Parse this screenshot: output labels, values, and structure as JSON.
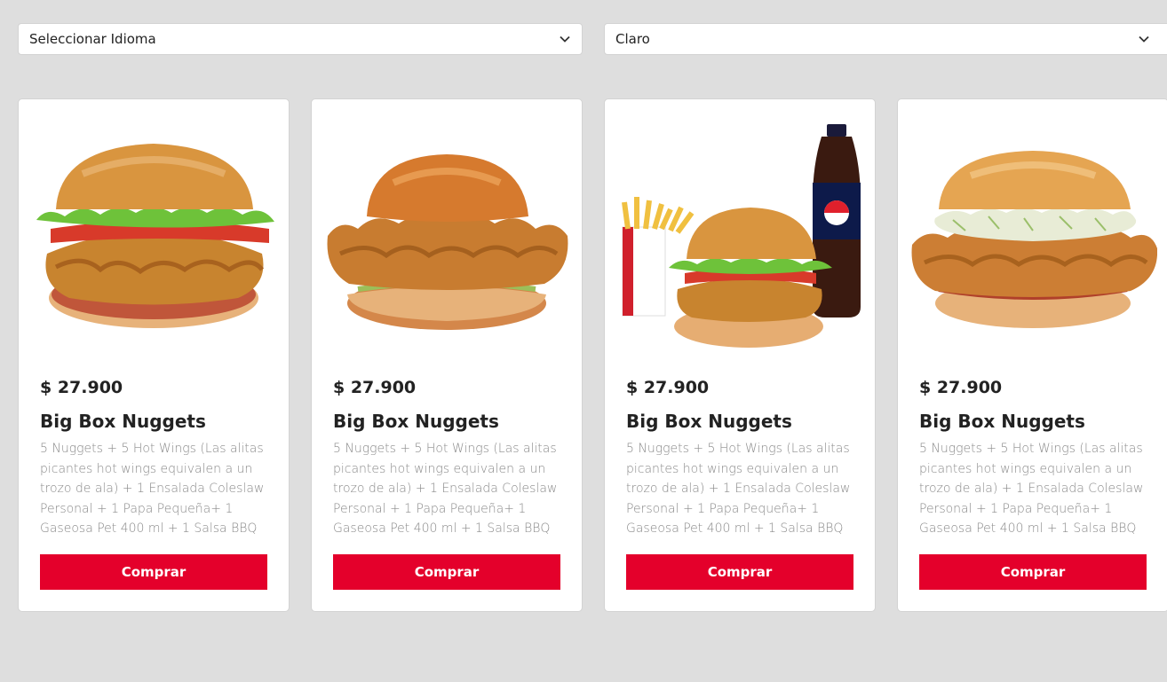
{
  "selectors": {
    "language": {
      "value": "Seleccionar Idioma",
      "icon": "chevron-down-icon"
    },
    "theme": {
      "value": "Claro",
      "icon": "chevron-down-icon"
    }
  },
  "products": [
    {
      "image": "burger-lettuce-tomato",
      "price": "$ 27.900",
      "name": "Big Box Nuggets",
      "description": "5 Nuggets + 5 Hot Wings (Las alitas picantes hot wings equivalen a un trozo de ala) + 1 Ensalada Coleslaw Personal + 1 Papa Pequeña+ 1 Gaseosa Pet 400 ml + 1 Salsa BBQ",
      "button": "Comprar"
    },
    {
      "image": "crispy-chicken-burger",
      "price": "$ 27.900",
      "name": "Big Box Nuggets",
      "description": "5 Nuggets + 5 Hot Wings (Las alitas picantes hot wings equivalen a un trozo de ala) + 1 Ensalada Coleslaw Personal + 1 Papa Pequeña+ 1 Gaseosa Pet 400 ml + 1 Salsa BBQ",
      "button": "Comprar"
    },
    {
      "image": "combo-burger-fries-soda",
      "price": "$ 27.900",
      "name": "Big Box Nuggets",
      "description": "5 Nuggets + 5 Hot Wings (Las alitas picantes hot wings equivalen a un trozo de ala) + 1 Ensalada Coleslaw Personal + 1 Papa Pequeña+ 1 Gaseosa Pet 400 ml + 1 Salsa BBQ",
      "button": "Comprar"
    },
    {
      "image": "coleslaw-chicken-burger",
      "price": "$ 27.900",
      "name": "Big Box Nuggets",
      "description": "5 Nuggets + 5 Hot Wings (Las alitas picantes hot wings equivalen a un trozo de ala) + 1 Ensalada Coleslaw Personal + 1 Papa Pequeña+ 1 Gaseosa Pet 400 ml + 1 Salsa BBQ",
      "button": "Comprar"
    }
  ],
  "colors": {
    "background": "#dedede",
    "card": "#ffffff",
    "accent": "#e4002b",
    "description": "#8a8a8a"
  }
}
